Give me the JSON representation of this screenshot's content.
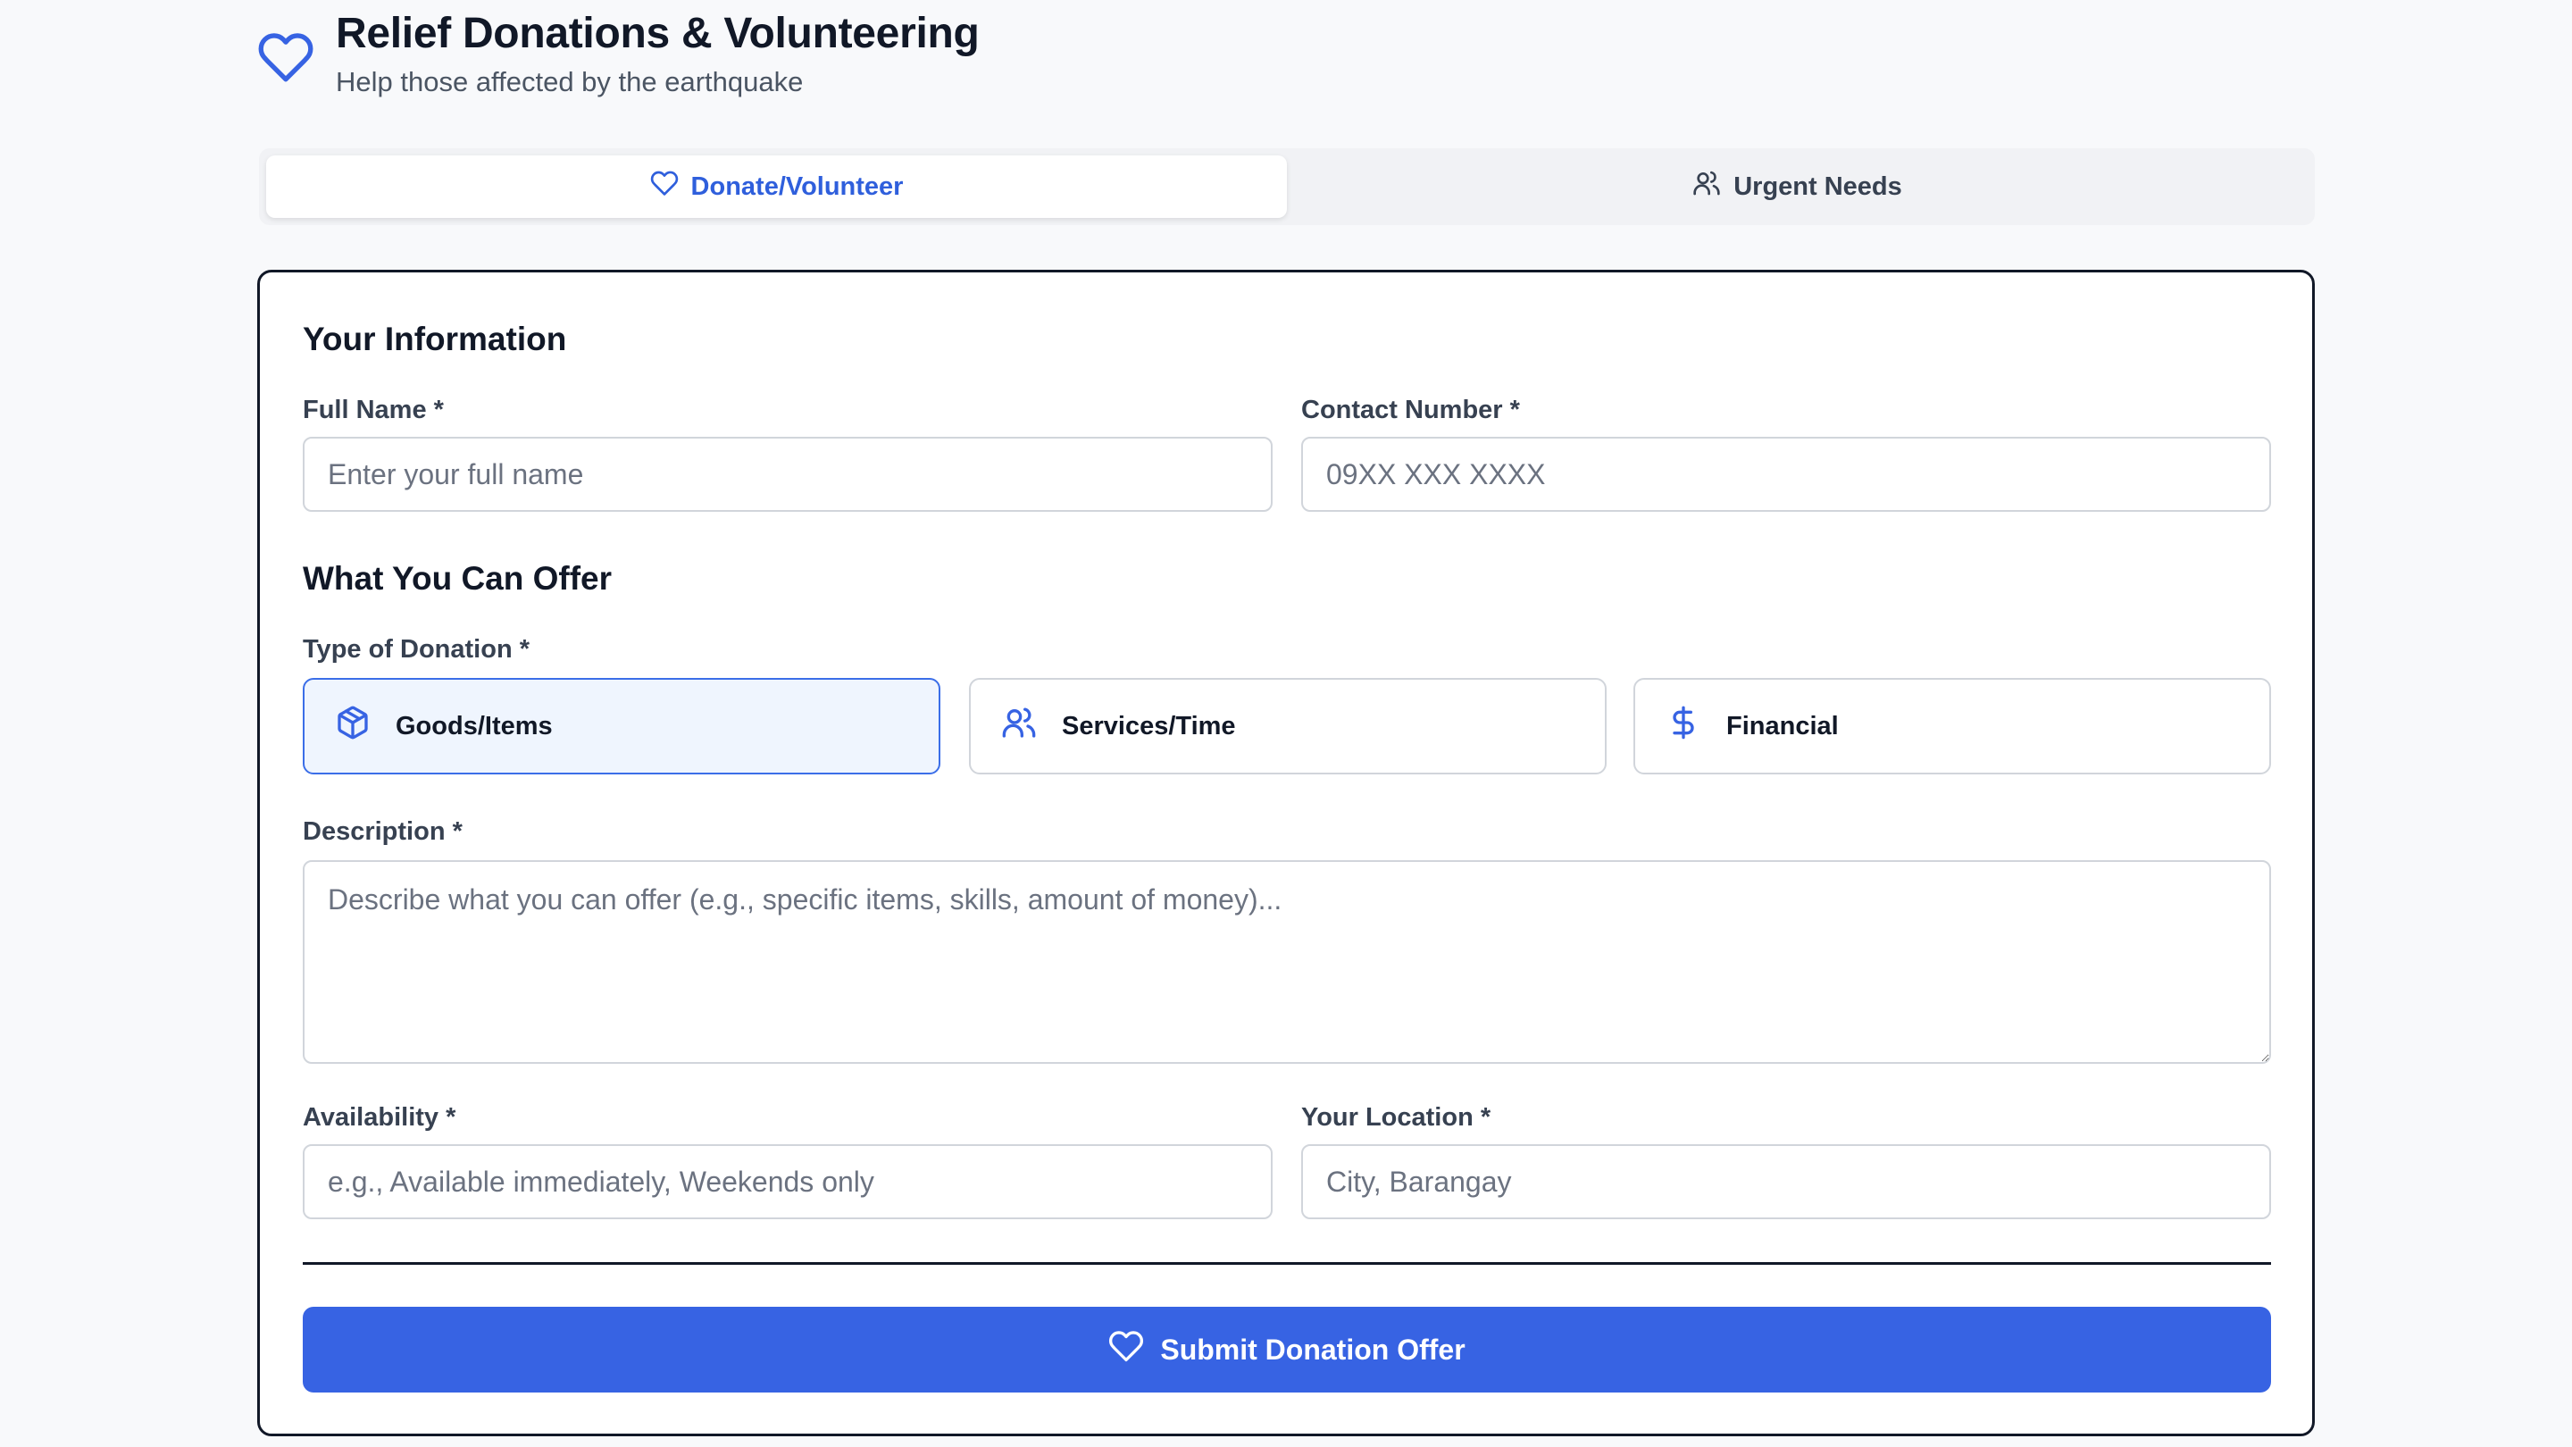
{
  "header": {
    "title": "Relief Donations & Volunteering",
    "subtitle": "Help those affected by the earthquake",
    "icon": "heart-icon"
  },
  "tabs": [
    {
      "label": "Donate/Volunteer",
      "icon": "heart-icon",
      "active": true
    },
    {
      "label": "Urgent Needs",
      "icon": "users-icon",
      "active": false
    }
  ],
  "form": {
    "section_info": "Your Information",
    "full_name": {
      "label": "Full Name *",
      "placeholder": "Enter your full name",
      "value": ""
    },
    "contact": {
      "label": "Contact Number *",
      "placeholder": "09XX XXX XXXX",
      "value": ""
    },
    "section_offer": "What You Can Offer",
    "donation_type": {
      "label": "Type of Donation *",
      "options": [
        {
          "label": "Goods/Items",
          "icon": "package-icon",
          "selected": true
        },
        {
          "label": "Services/Time",
          "icon": "users-icon",
          "selected": false
        },
        {
          "label": "Financial",
          "icon": "dollar-icon",
          "selected": false
        }
      ]
    },
    "description": {
      "label": "Description *",
      "placeholder": "Describe what you can offer (e.g., specific items, skills, amount of money)...",
      "value": ""
    },
    "availability": {
      "label": "Availability *",
      "placeholder": "e.g., Available immediately, Weekends only",
      "value": ""
    },
    "location": {
      "label": "Your Location *",
      "placeholder": "City, Barangay",
      "value": ""
    },
    "submit_label": "Submit Donation Offer"
  },
  "colors": {
    "accent": "#3763e3",
    "tab_active_text": "#2f5fdc",
    "selected_bg": "#eff5fe",
    "selected_border": "#3b6ee8"
  }
}
